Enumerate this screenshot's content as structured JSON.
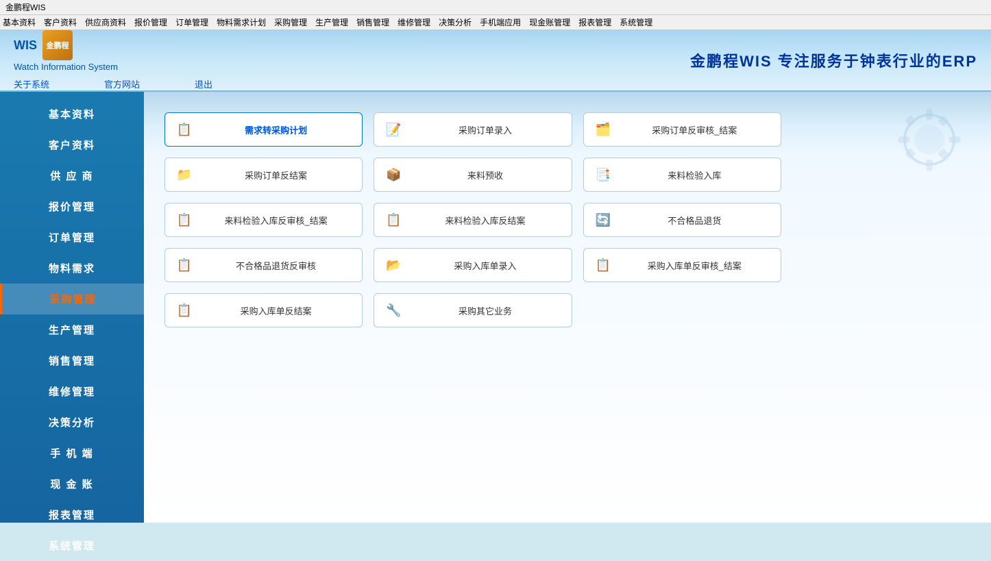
{
  "titleBar": {
    "title": "金鹏程WIS"
  },
  "menuBar": {
    "items": [
      "基本资料",
      "客户资料",
      "供应商资料",
      "报价管理",
      "订单管理",
      "物料需求计划",
      "采购管理",
      "生产管理",
      "销售管理",
      "维修管理",
      "决策分析",
      "手机端应用",
      "现金账管理",
      "报表管理",
      "系统管理"
    ]
  },
  "header": {
    "logo": "金鹏程",
    "logoTop": "WIS",
    "subtitle": "Watch Information System",
    "tagline": "金鹏程WIS  专注服务于钟表行业的ERP",
    "navLinks": [
      "关于系统",
      "官方网站",
      "退出"
    ]
  },
  "sidebar": {
    "items": [
      {
        "label": "基本资料",
        "active": false
      },
      {
        "label": "客户资料",
        "active": false
      },
      {
        "label": "供 应 商",
        "active": false
      },
      {
        "label": "报价管理",
        "active": false
      },
      {
        "label": "订单管理",
        "active": false
      },
      {
        "label": "物料需求",
        "active": false
      },
      {
        "label": "采购管理",
        "active": true
      },
      {
        "label": "生产管理",
        "active": false
      },
      {
        "label": "销售管理",
        "active": false
      },
      {
        "label": "维修管理",
        "active": false
      },
      {
        "label": "决策分析",
        "active": false
      },
      {
        "label": "手 机 端",
        "active": false
      },
      {
        "label": "现 金 账",
        "active": false
      },
      {
        "label": "报表管理",
        "active": false
      },
      {
        "label": "系统管理",
        "active": false
      }
    ]
  },
  "content": {
    "buttons": [
      {
        "label": "需求转采购计划",
        "icon": "📋",
        "active": true
      },
      {
        "label": "采购订单录入",
        "icon": "📝",
        "active": false
      },
      {
        "label": "采购订单反审核_结案",
        "icon": "🗂️",
        "active": false
      },
      {
        "label": "采购订单反结案",
        "icon": "📁",
        "active": false
      },
      {
        "label": "来料预收",
        "icon": "📦",
        "active": false
      },
      {
        "label": "来料检验入库",
        "icon": "📑",
        "active": false
      },
      {
        "label": "来料检验入库反审核_结案",
        "icon": "📋",
        "active": false
      },
      {
        "label": "来料检验入库反结案",
        "icon": "📋",
        "active": false
      },
      {
        "label": "不合格品退货",
        "icon": "🔄",
        "active": false
      },
      {
        "label": "不合格品退货反审核",
        "icon": "📋",
        "active": false
      },
      {
        "label": "采购入库单录入",
        "icon": "📂",
        "active": false
      },
      {
        "label": "采购入库单反审核_结案",
        "icon": "📋",
        "active": false
      },
      {
        "label": "采购入库单反结案",
        "icon": "📋",
        "active": false
      },
      {
        "label": "采购其它业务",
        "icon": "🔧",
        "active": false
      }
    ]
  }
}
